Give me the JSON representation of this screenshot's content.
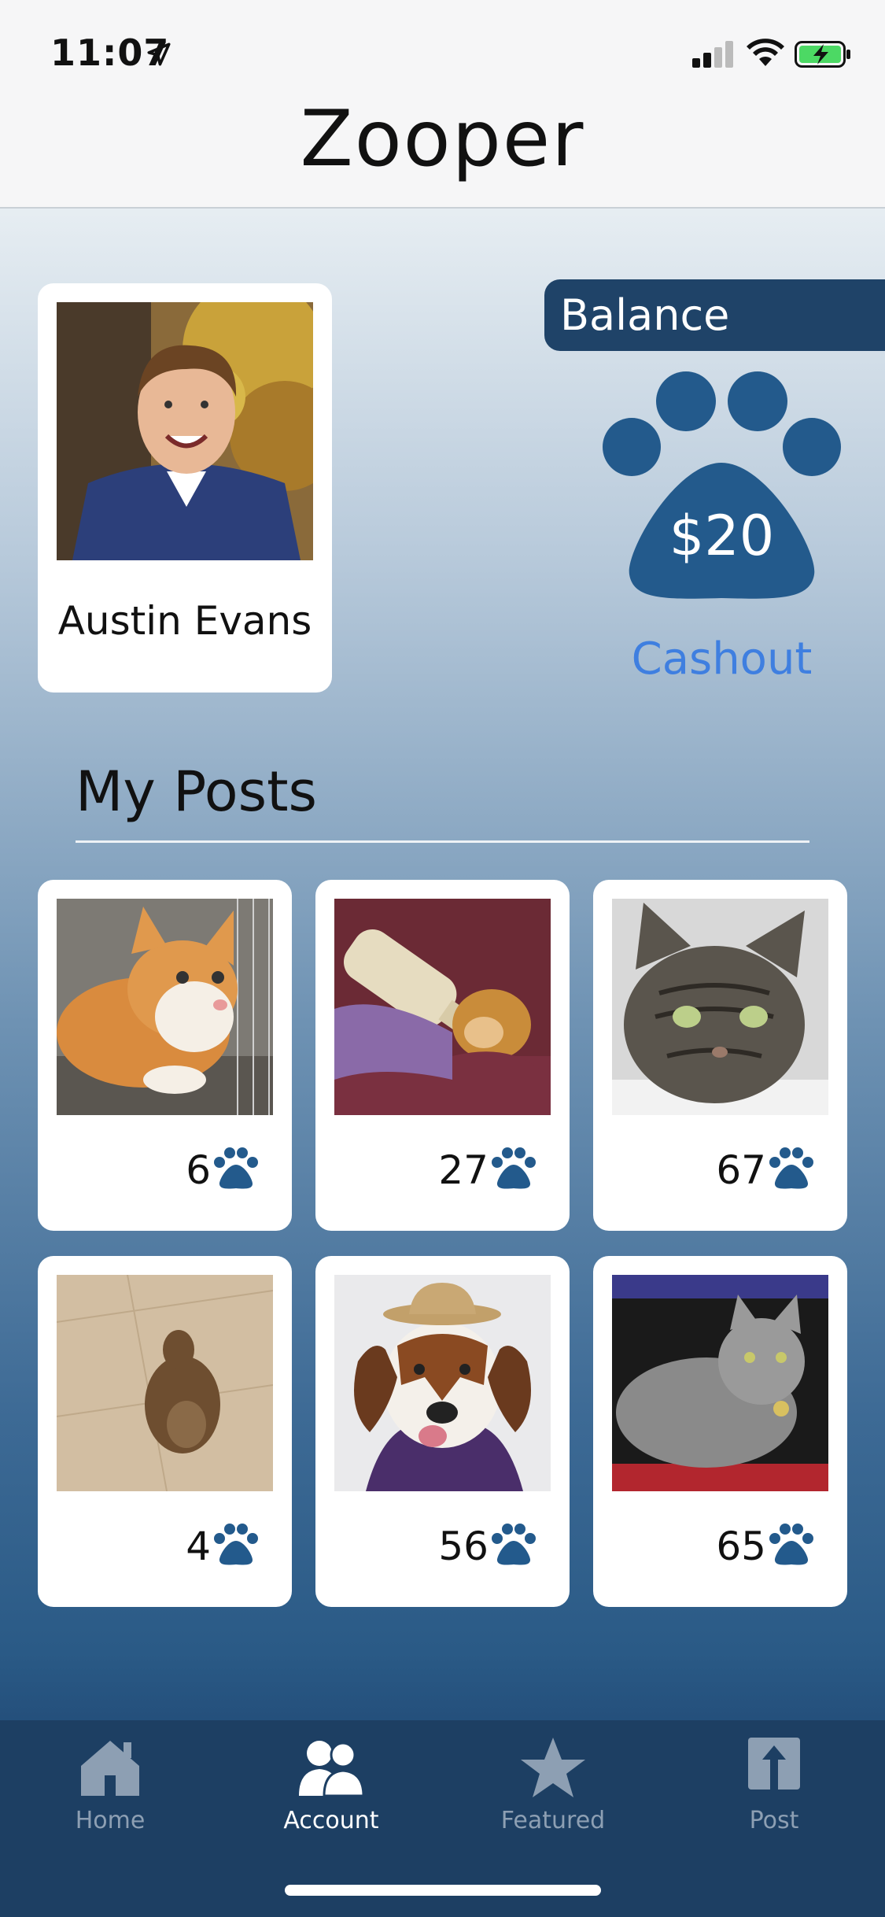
{
  "status_bar": {
    "time": "11:07"
  },
  "app_title": "Zooper",
  "profile": {
    "name": "Austin Evans"
  },
  "balance": {
    "label": "Balance",
    "amount": "$20",
    "cashout_label": "Cashout"
  },
  "posts": {
    "heading": "My Posts",
    "items": [
      {
        "count": "6",
        "subject": "orange-white-cat"
      },
      {
        "count": "27",
        "subject": "bottle-fed-monkey"
      },
      {
        "count": "67",
        "subject": "tabby-cat"
      },
      {
        "count": "4",
        "subject": "prairie-dog"
      },
      {
        "count": "56",
        "subject": "basset-hound-hat"
      },
      {
        "count": "65",
        "subject": "gray-cat"
      }
    ]
  },
  "tabbar": {
    "tabs": [
      {
        "label": "Home",
        "icon": "home-icon",
        "active": false
      },
      {
        "label": "Account",
        "icon": "people-icon",
        "active": true
      },
      {
        "label": "Featured",
        "icon": "star-icon",
        "active": false
      },
      {
        "label": "Post",
        "icon": "upload-icon",
        "active": false
      }
    ]
  },
  "colors": {
    "navy": "#1f4368",
    "paw": "#235a8c",
    "link": "#3f7fe0",
    "tabbar": "#1d3f63"
  }
}
